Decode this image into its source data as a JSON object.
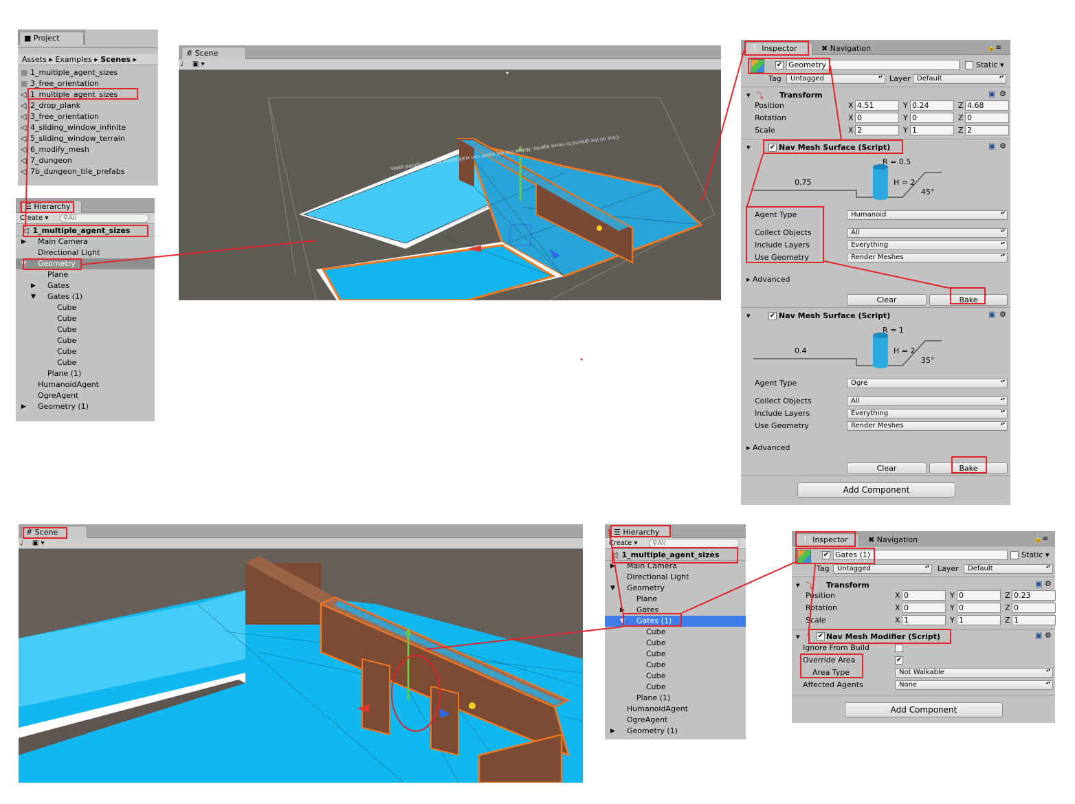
{
  "project": {
    "tab": "Project",
    "breadcrumb": [
      "Assets",
      "Examples",
      "Scenes"
    ],
    "folders": [
      "1_multiple_agent_sizes",
      "3_free_orientation"
    ],
    "scenes": [
      "1_multiple_agent_sizes",
      "2_drop_plank",
      "3_free_orientation",
      "4_sliding_window_infinite",
      "5_sliding_window_terrain",
      "6_modify_mesh",
      "7_dungeon",
      "7b_dungeon_tile_prefabs"
    ]
  },
  "hierarchy1": {
    "tab": "Hierarchy",
    "create": "Create",
    "search_placeholder": "All",
    "scene_root": "1_multiple_agent_sizes",
    "items": [
      {
        "label": "Main Camera",
        "indent": 1,
        "arrow": "right"
      },
      {
        "label": "Directional Light",
        "indent": 1,
        "arrow": ""
      },
      {
        "label": "Geometry",
        "indent": 1,
        "arrow": "down",
        "selected": true
      },
      {
        "label": "Plane",
        "indent": 2,
        "arrow": ""
      },
      {
        "label": "Gates",
        "indent": 2,
        "arrow": "right"
      },
      {
        "label": "Gates (1)",
        "indent": 2,
        "arrow": "down"
      },
      {
        "label": "Cube",
        "indent": 3,
        "arrow": ""
      },
      {
        "label": "Cube",
        "indent": 3,
        "arrow": ""
      },
      {
        "label": "Cube",
        "indent": 3,
        "arrow": ""
      },
      {
        "label": "Cube",
        "indent": 3,
        "arrow": ""
      },
      {
        "label": "Cube",
        "indent": 3,
        "arrow": ""
      },
      {
        "label": "Cube",
        "indent": 3,
        "arrow": ""
      },
      {
        "label": "Plane (1)",
        "indent": 2,
        "arrow": ""
      },
      {
        "label": "HumanoidAgent",
        "indent": 1,
        "arrow": ""
      },
      {
        "label": "OgreAgent",
        "indent": 1,
        "arrow": ""
      },
      {
        "label": "Geometry (1)",
        "indent": 1,
        "arrow": "right"
      }
    ]
  },
  "scene1": {
    "tab": "Scene",
    "overlay_text": "Click on the ground to move agents. Notice the red agent can walk below the highlighted gates."
  },
  "inspector1": {
    "tab": "Inspector",
    "tab2": "Navigation",
    "object_name": "Geometry",
    "static_label": "Static",
    "tag_label": "Tag",
    "tag_value": "Untagged",
    "layer_label": "Layer",
    "layer_value": "Default",
    "transform": {
      "title": "Transform",
      "rows": [
        {
          "label": "Position",
          "x": "4.51",
          "y": "0.24",
          "z": "4.68"
        },
        {
          "label": "Rotation",
          "x": "0",
          "y": "0",
          "z": "0"
        },
        {
          "label": "Scale",
          "x": "2",
          "y": "1",
          "z": "2"
        }
      ]
    },
    "surfaces": [
      {
        "title": "Nav Mesh Surface (Script)",
        "radius": "R = 0.5",
        "height": "H = 2",
        "step": "0.75",
        "slope": "45°",
        "agent_type_label": "Agent Type",
        "agent_type": "Humanoid",
        "collect_label": "Collect Objects",
        "collect": "All",
        "include_label": "Include Layers",
        "include": "Everything",
        "use_label": "Use Geometry",
        "use": "Render Meshes",
        "advanced": "Advanced",
        "clear": "Clear",
        "bake": "Bake"
      },
      {
        "title": "Nav Mesh Surface (Script)",
        "radius": "R = 1",
        "height": "H = 2",
        "step": "0.4",
        "slope": "35°",
        "agent_type_label": "Agent Type",
        "agent_type": "Ogre",
        "collect_label": "Collect Objects",
        "collect": "All",
        "include_label": "Include Layers",
        "include": "Everything",
        "use_label": "Use Geometry",
        "use": "Render Meshes",
        "advanced": "Advanced",
        "clear": "Clear",
        "bake": "Bake"
      }
    ],
    "add_component": "Add Component"
  },
  "scene2": {
    "tab": "Scene"
  },
  "hierarchy2": {
    "tab": "Hierarchy",
    "create": "Create",
    "search_placeholder": "All",
    "scene_root": "1_multiple_agent_sizes",
    "items": [
      {
        "label": "Main Camera",
        "indent": 1,
        "arrow": "right"
      },
      {
        "label": "Directional Light",
        "indent": 1,
        "arrow": ""
      },
      {
        "label": "Geometry",
        "indent": 1,
        "arrow": "down"
      },
      {
        "label": "Plane",
        "indent": 2,
        "arrow": ""
      },
      {
        "label": "Gates",
        "indent": 2,
        "arrow": "right"
      },
      {
        "label": "Gates (1)",
        "indent": 2,
        "arrow": "down",
        "selected": true
      },
      {
        "label": "Cube",
        "indent": 3,
        "arrow": ""
      },
      {
        "label": "Cube",
        "indent": 3,
        "arrow": ""
      },
      {
        "label": "Cube",
        "indent": 3,
        "arrow": ""
      },
      {
        "label": "Cube",
        "indent": 3,
        "arrow": ""
      },
      {
        "label": "Cube",
        "indent": 3,
        "arrow": ""
      },
      {
        "label": "Cube",
        "indent": 3,
        "arrow": ""
      },
      {
        "label": "Plane (1)",
        "indent": 2,
        "arrow": ""
      },
      {
        "label": "HumanoidAgent",
        "indent": 1,
        "arrow": ""
      },
      {
        "label": "OgreAgent",
        "indent": 1,
        "arrow": ""
      },
      {
        "label": "Geometry (1)",
        "indent": 1,
        "arrow": "right"
      }
    ]
  },
  "inspector2": {
    "tab": "Inspector",
    "tab2": "Navigation",
    "object_name": "Gates (1)",
    "static_label": "Static",
    "tag_label": "Tag",
    "tag_value": "Untagged",
    "layer_label": "Layer",
    "layer_value": "Default",
    "transform": {
      "title": "Transform",
      "rows": [
        {
          "label": "Position",
          "x": "0",
          "y": "0",
          "z": "0.23"
        },
        {
          "label": "Rotation",
          "x": "0",
          "y": "0",
          "z": "0"
        },
        {
          "label": "Scale",
          "x": "1",
          "y": "1",
          "z": "1"
        }
      ]
    },
    "modifier": {
      "title": "Nav Mesh Modifier (Script)",
      "ignore_label": "Ignore From Build",
      "ignore": false,
      "override_label": "Override Area",
      "override": true,
      "area_label": "Area Type",
      "area": "Not Walkable",
      "affected_label": "Affected Agents",
      "affected": "None"
    },
    "add_component": "Add Component"
  },
  "colors": {
    "annotation": "#e2232a",
    "navmesh": "#00b4f0",
    "edge": "#f07820",
    "selection": "#3e7ce7"
  }
}
